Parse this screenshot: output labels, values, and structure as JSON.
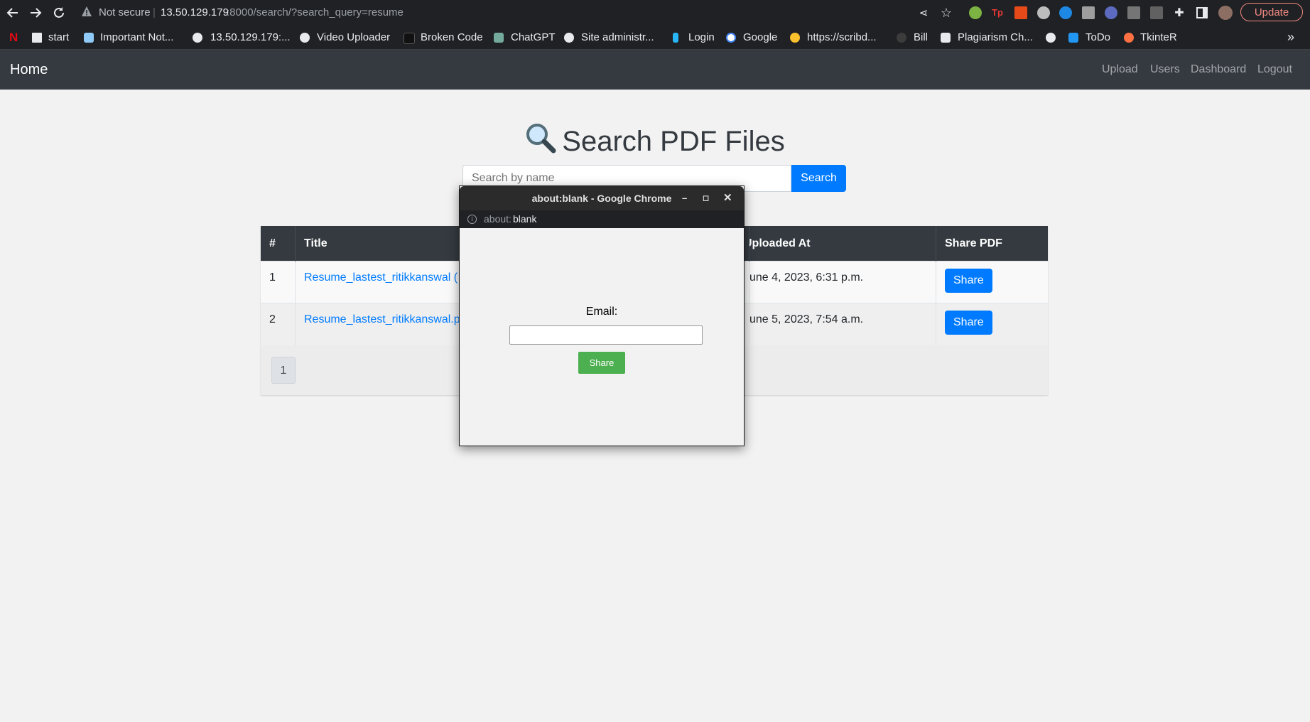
{
  "browser": {
    "url_security": "Not secure",
    "url_host": "13.50.129.179",
    "url_path": ":8000/search/?search_query=resume",
    "update_label": "Update",
    "bookmarks": [
      "start",
      "Important Not...",
      "13.50.129.179:...",
      "Video Uploader",
      "Broken Code",
      "ChatGPT",
      "Site administr...",
      "Login",
      "Google",
      "https://scribd...",
      "Bill",
      "Plagiarism Ch...",
      "ToDo",
      "TkinteR"
    ],
    "more_bookmarks": "»"
  },
  "navbar": {
    "brand": "Home",
    "links": [
      "Upload",
      "Users",
      "Dashboard",
      "Logout"
    ]
  },
  "page": {
    "heading": "Search PDF Files",
    "search_placeholder": "Search by name",
    "search_button": "Search"
  },
  "table": {
    "headers": [
      "#",
      "Title",
      "Uploaded At",
      "Share PDF"
    ],
    "rows": [
      {
        "num": "1",
        "title": "Resume_lastest_ritikkanswal (",
        "uploaded": "une 4, 2023, 6:31 p.m.",
        "share": "Share"
      },
      {
        "num": "2",
        "title": "Resume_lastest_ritikkanswal.p",
        "uploaded": "une 5, 2023, 7:54 a.m.",
        "share": "Share"
      }
    ],
    "pagination": [
      "1"
    ]
  },
  "popup": {
    "title": "about:blank - Google Chrome",
    "url_scheme": "about:",
    "url_rest": "blank",
    "email_label": "Email:",
    "share_button": "Share"
  },
  "colors": {
    "primary": "#007bff",
    "navbar": "#343a40",
    "popup_share": "#4caf50"
  }
}
